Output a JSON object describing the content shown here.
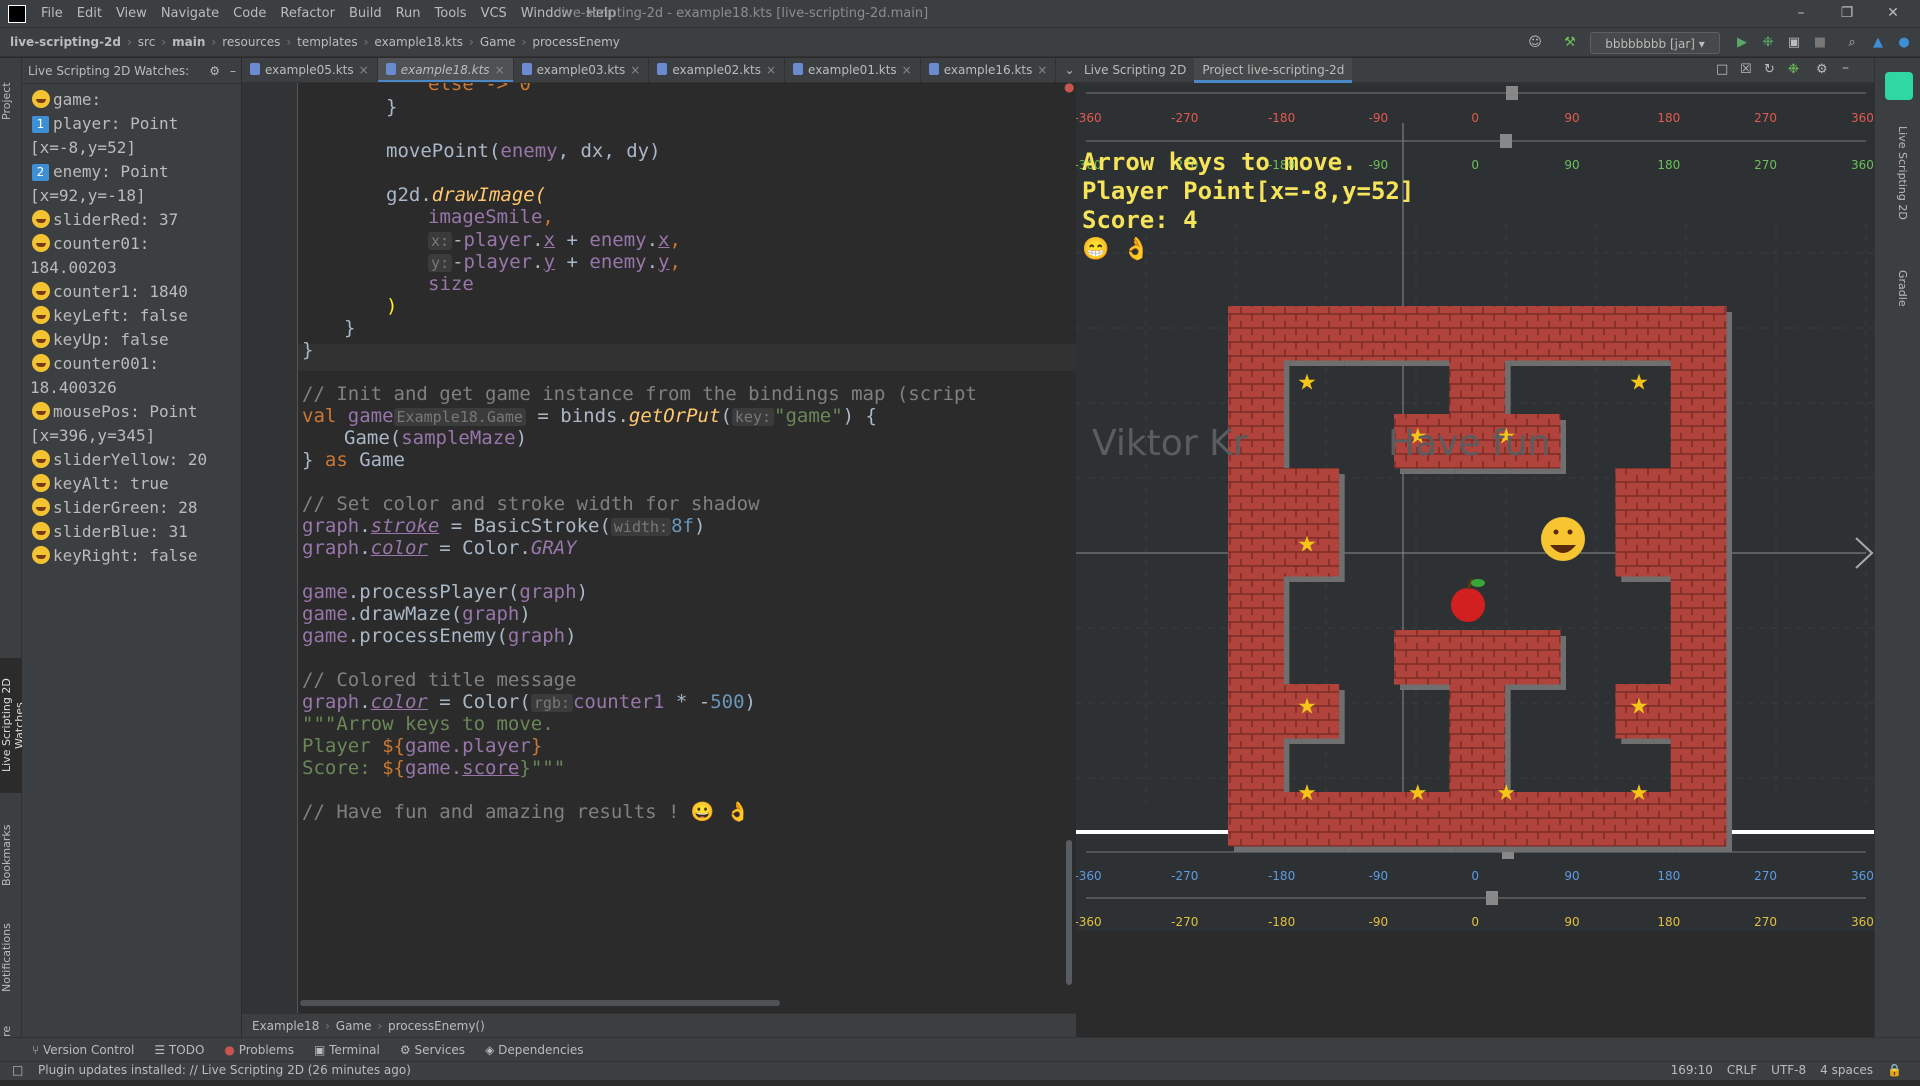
{
  "menubar": {
    "items": [
      "File",
      "Edit",
      "View",
      "Navigate",
      "Code",
      "Refactor",
      "Build",
      "Run",
      "Tools",
      "VCS",
      "Window",
      "Help"
    ],
    "title": "live-scripting-2d - example18.kts [live-scripting-2d.main]"
  },
  "navbar": {
    "crumbs": [
      "live-scripting-2d",
      "src",
      "main",
      "resources",
      "templates",
      "example18.kts",
      "Game",
      "processEnemy"
    ],
    "run_config": "bbbbbbbb [jar]"
  },
  "watches": {
    "title": "Live Scripting 2D Watches:",
    "lines": [
      {
        "icon": "smile",
        "text": "game:"
      },
      {
        "icon": "num",
        "num": "1",
        "text": "player: Point"
      },
      {
        "icon": "",
        "text": "[x=-8,y=52]"
      },
      {
        "icon": "num",
        "num": "2",
        "text": "enemy: Point"
      },
      {
        "icon": "",
        "text": "[x=92,y=-18]"
      },
      {
        "icon": "smile",
        "text": "sliderRed: 37"
      },
      {
        "icon": "smile",
        "text": "counter01:"
      },
      {
        "icon": "",
        "text": "184.00203"
      },
      {
        "icon": "smile",
        "text": "counter1: 1840"
      },
      {
        "icon": "smile",
        "text": "keyLeft: false"
      },
      {
        "icon": "smile",
        "text": "keyUp: false"
      },
      {
        "icon": "smile",
        "text": "counter001:"
      },
      {
        "icon": "",
        "text": "18.400326"
      },
      {
        "icon": "smile",
        "text": "mousePos: Point"
      },
      {
        "icon": "",
        "text": "[x=396,y=345]"
      },
      {
        "icon": "smile",
        "text": "sliderYellow: 20"
      },
      {
        "icon": "smile",
        "text": "keyAlt: true"
      },
      {
        "icon": "smile",
        "text": "sliderGreen: 28"
      },
      {
        "icon": "smile",
        "text": "sliderBlue: 31"
      },
      {
        "icon": "smile",
        "text": "keyRight: false"
      }
    ]
  },
  "editor_tabs": [
    "example05.kts",
    "example18.kts",
    "example03.kts",
    "example02.kts",
    "example01.kts",
    "example16.kts"
  ],
  "code": {
    "l1": "else -> 0",
    "l2": "}",
    "l3a": "movePoint(",
    "l3b": "enemy",
    ", dx, dy)": "",
    "c_move_rest": ", dx, dy)",
    "c_g2d": "g2d.",
    "c_drawImage": "drawImage",
    "c_paren": "(",
    "c_imageSmile": "imageSmile",
    ",": ",",
    "c_hint_x": "x:",
    "c_neg": "-",
    "c_player": "player",
    ".": ".",
    "c_xx": "x",
    "c_plus": " + ",
    "c_enemy": "enemy",
    "c_yy": "y",
    "c_hint_y": "y:",
    "c_size": "size",
    "c_close": ")",
    "c_brace": "}",
    "c_cmt1": "// Init and get game instance from the bindings map (script",
    "c_val": "val ",
    "c_game": "game",
    "c_type": "Example18.Game",
    "c_eq": " = binds.",
    "c_getOrPut": "getOrPut",
    "c_key": "key:",
    "c_strgame": "\"game\"",
    "c_rest1": ") {",
    "c_gamecall": "Game(",
    "c_maze": "sampleMaze",
    "c_as": "as",
    "c_GameT": " Game",
    "c_cmt2": "// Set color and stroke width for shadow",
    "c_graph": "graph",
    "c_stroke": "stroke",
    "c_basic": " = BasicStroke(",
    "c_width": "width:",
    "c_8f": "8f",
    "c_color": "color",
    "c_colorGray": " = Color.",
    "c_GRAY": "GRAY",
    "c_pp": ".processPlayer(",
    "c_dm": ".drawMaze(",
    "c_pe": ".processEnemy(",
    "c_cmt3": "// Colored title message",
    "c_colorCall": " = Color(",
    "c_rgb": "rgb:",
    "c_counter1": "counter1",
    "c_mult": " * -",
    "c_500": "500",
    "c_tq1": "\"\"\"Arrow keys to move.",
    "c_player_tpl": "Player ",
    "c_tpl_open": "${",
    "c_gp": "game.player",
    "c_tpl_close": "}",
    "c_score_tpl": "Score: ",
    "c_gs": "game.",
    "c_score": "score",
    "c_tq2": "}\"\"\"",
    "c_cmt4": "// Have fun and amazing results ! 😀 👌"
  },
  "editor_breadcrumb": [
    "Example18",
    "Game",
    "processEnemy()"
  ],
  "right_tabs": [
    "Live Scripting 2D",
    "Project live-scripting-2d"
  ],
  "right_stripe": [
    "Live Scripting 2D",
    "Gradle"
  ],
  "left_stripe": [
    "Project",
    "Live Scripting 2D Watches",
    "Bookmarks",
    "Notifications",
    "Structure"
  ],
  "preview": {
    "line1": "Arrow keys to move.",
    "line2": "Player Point[x=-8,y=52]",
    "line3": "Score: 4",
    "watermark": "Viktor Kr",
    "watermark2": "Have fun",
    "ruler_top_red": [
      "-360",
      "-270",
      "-180",
      "-90",
      "0",
      "90",
      "180",
      "270",
      "360"
    ],
    "ruler_top_green": [
      "-360",
      "-270",
      "-180",
      "-90",
      "0",
      "90",
      "180",
      "270",
      "360"
    ],
    "ruler_bottom_blue": [
      "-360",
      "-270",
      "-180",
      "-90",
      "0",
      "90",
      "180",
      "270",
      "360"
    ],
    "ruler_bottom_yellow": [
      "-360",
      "-270",
      "-180",
      "-90",
      "0",
      "90",
      "180",
      "270",
      "360"
    ],
    "colors": {
      "red": "#e05a4f",
      "green": "#6bbf59",
      "blue": "#5c9be0",
      "yellow": "#e0c040",
      "brick": "#b0443c",
      "text": "#f5e35a"
    }
  },
  "toolwin": [
    "Version Control",
    "TODO",
    "Problems",
    "Terminal",
    "Services",
    "Dependencies"
  ],
  "status": {
    "msg": "Plugin updates installed: // Live Scripting 2D (26 minutes ago)",
    "pos": "169:10",
    "eol": "CRLF",
    "enc": "UTF-8",
    "indent": "4 spaces"
  }
}
